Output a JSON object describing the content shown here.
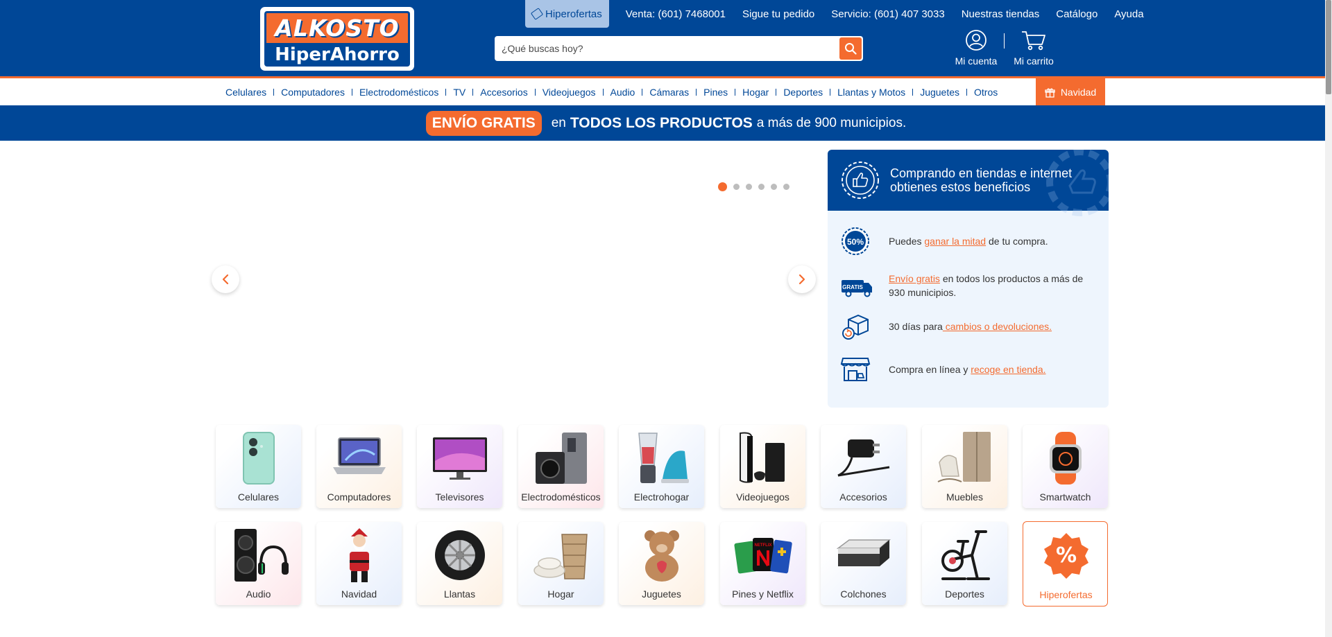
{
  "logo": {
    "top": "ALKOSTO",
    "bottom": "HiperAhorro"
  },
  "topnav": {
    "hiperofertas": "Hiperofertas",
    "venta": "Venta: (601) 7468001",
    "pedido": "Sigue tu pedido",
    "servicio": "Servicio: (601) 407 3033",
    "tiendas": "Nuestras tiendas",
    "catalogo": "Catálogo",
    "ayuda": "Ayuda"
  },
  "search": {
    "placeholder": "¿Qué buscas hoy?"
  },
  "account": {
    "label": "Mi cuenta"
  },
  "cart": {
    "label": "Mi carrito"
  },
  "categories_nav": [
    "Celulares",
    "Computadores",
    "Electrodomésticos",
    "TV",
    "Accesorios",
    "Videojuegos",
    "Audio",
    "Cámaras",
    "Pines",
    "Hogar",
    "Deportes",
    "Llantas y Motos",
    "Juguetes",
    "Otros"
  ],
  "navidad_tab": "Navidad",
  "promo": {
    "pill": "ENVÍO GRATIS",
    "t1": "en",
    "t2": "TODOS LOS PRODUCTOS",
    "t3": "a más de 900 municipios."
  },
  "slider": {
    "slides": 6,
    "active": 1
  },
  "benefits": {
    "title": "Comprando en tiendas e internet obtienes estos beneficios",
    "b1": {
      "pre": "Puedes ",
      "link": "ganar la mitad",
      "post": " de tu compra."
    },
    "b2": {
      "pre": "",
      "link": "Envío gratis",
      "post": " en todos los productos a más de 930 municipios."
    },
    "b3": {
      "pre": "30 días para",
      "link": " cambios o devoluciones.",
      "post": ""
    },
    "b4": {
      "pre": "Compra en línea y ",
      "link": "recoge en tienda.",
      "post": ""
    },
    "icon_percent": "50%",
    "icon_truck": "GRATIS"
  },
  "tiles": [
    "Celulares",
    "Computadores",
    "Televisores",
    "Electrodomésticos",
    "Electrohogar",
    "Videojuegos",
    "Accesorios",
    "Muebles",
    "Smartwatch",
    "Audio",
    "Navidad",
    "Llantas",
    "Hogar",
    "Juguetes",
    "Pines y Netflix",
    "Colchones",
    "Deportes",
    "Hiperofertas"
  ],
  "tile_art": {
    "hiperofertas_symbol": "%",
    "pines_card": "NETFLIX"
  },
  "colors": {
    "brand_blue": "#004797",
    "brand_orange": "#f46b2f"
  }
}
